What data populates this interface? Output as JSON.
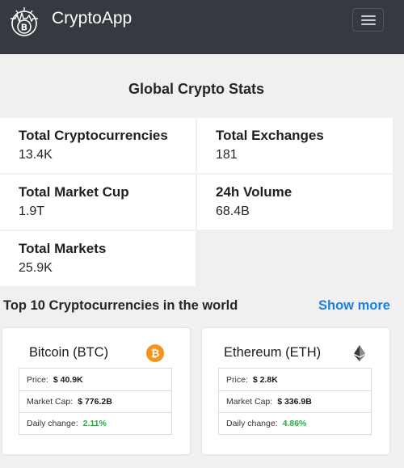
{
  "navbar": {
    "brand": "CryptoApp"
  },
  "stats": {
    "title": "Global Crypto Stats",
    "items": [
      {
        "label": "Total Cryptocurrencies",
        "value": "13.4K"
      },
      {
        "label": "Total Exchanges",
        "value": "181"
      },
      {
        "label": "Total Market Cup",
        "value": "1.9T"
      },
      {
        "label": "24h Volume",
        "value": "68.4B"
      },
      {
        "label": "Total Markets",
        "value": "25.9K"
      }
    ]
  },
  "top": {
    "title": "Top 10 Cryptocurrencies in the world",
    "show_more": "Show more"
  },
  "coins": [
    {
      "name": "Bitcoin (BTC)",
      "icon": "bitcoin-icon",
      "icon_color": "#f7931a",
      "price_label": "Price:",
      "price": "$ 40.9K",
      "cap_label": "Market Cap:",
      "cap": "$ 776.2B",
      "change_label": "Daily change:",
      "change": "2.11%"
    },
    {
      "name": "Ethereum (ETH)",
      "icon": "ethereum-icon",
      "icon_color": "#3c3c3d",
      "price_label": "Price:",
      "price": "$ 2.8K",
      "cap_label": "Market Cap:",
      "cap": "$ 336.9B",
      "change_label": "Daily change:",
      "change": "4.86%"
    }
  ],
  "colors": {
    "navbar": "#343a40",
    "link": "#1f7ee0",
    "positive": "#28a745"
  }
}
